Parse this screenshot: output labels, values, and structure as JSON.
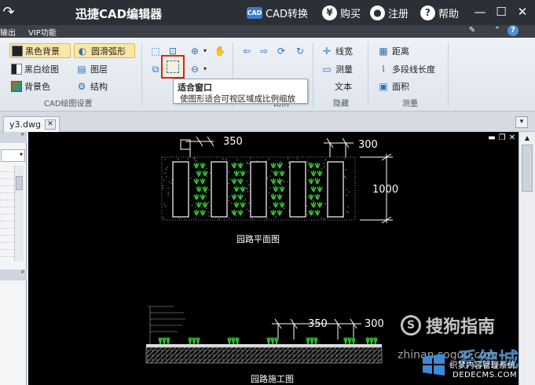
{
  "titlebar": {
    "title": "迅捷CAD编辑器",
    "cad_convert": "CAD转换",
    "cad_badge": "CAD",
    "buy": "购买",
    "register": "注册",
    "help": "帮助"
  },
  "menubar": {
    "items": [
      "输出",
      "VIP功能"
    ]
  },
  "ribbon": {
    "cad_settings": {
      "black_bg": "黑色背景",
      "smooth_arc": "圆滑弧形",
      "bw_draw": "黑白绘图",
      "layers": "图层",
      "bg_color": "背景色",
      "structure": "结构",
      "group_label": "CAD绘图设置"
    },
    "hidden": {
      "linewidth": "线宽",
      "measure": "测量",
      "text": "文本",
      "group_label": "隐藏"
    },
    "measure": {
      "distance": "距离",
      "polyline_length": "多段线长度",
      "area": "面积",
      "group_label": "测量"
    },
    "view_group_partial": "比例"
  },
  "tooltip": {
    "title": "适合窗口",
    "description": "使图形适合可视区域成比例缩放"
  },
  "tabs": {
    "document": "y3.dwg"
  },
  "drawing": {
    "dim_350_top": "350",
    "dim_300_top": "300",
    "dim_1000": "1000",
    "plan_caption": "园路平面图",
    "dim_350_bottom": "350",
    "dim_300_bottom": "300",
    "section_caption": "园路施工图"
  },
  "watermarks": {
    "sogou": "搜狗指南",
    "sogou_url": "zhinan.sogou.com",
    "xitongcheng": "系统城",
    "site_url": "DEDECMS.COM",
    "site_desc": "织梦内容管理系统"
  },
  "colors": {
    "titlebar_bg": "#2b2f36",
    "highlight_red": "#e02020",
    "plant_green": "#2ec12e",
    "cad_bg": "#000000"
  }
}
